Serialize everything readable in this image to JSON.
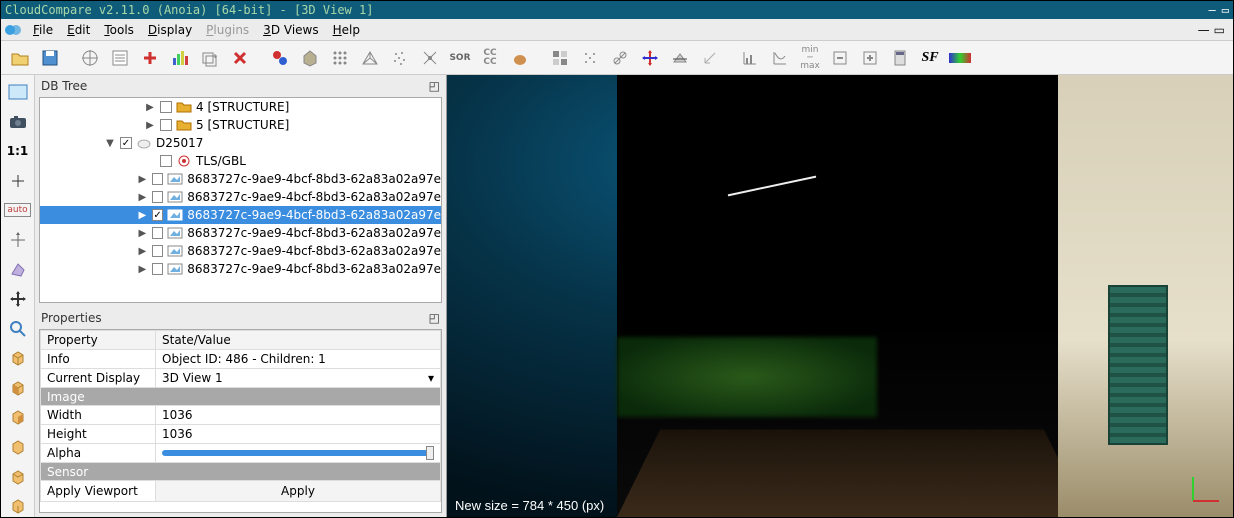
{
  "titlebar": {
    "text": "CloudCompare v2.11.0 (Anoia) [64-bit] - [3D View 1]"
  },
  "menu": {
    "items": [
      "File",
      "Edit",
      "Tools",
      "Display",
      "Plugins",
      "3D Views",
      "Help"
    ],
    "disabled_index": 4
  },
  "db_tree": {
    "title": "DB Tree",
    "rows": [
      {
        "indent": 100,
        "arrow": "▶",
        "checked": false,
        "icon": "folder",
        "label": "4 [STRUCTURE]"
      },
      {
        "indent": 100,
        "arrow": "▶",
        "checked": false,
        "icon": "folder",
        "label": "5 [STRUCTURE]"
      },
      {
        "indent": 60,
        "arrow": "▼",
        "checked": true,
        "icon": "cloud",
        "label": "D25017"
      },
      {
        "indent": 100,
        "arrow": "",
        "checked": false,
        "icon": "target",
        "label": "TLS/GBL"
      },
      {
        "indent": 100,
        "arrow": "▶",
        "checked": false,
        "icon": "image",
        "label": "8683727c-9ae9-4bcf-8bd3-62a83a02a97e"
      },
      {
        "indent": 100,
        "arrow": "▶",
        "checked": false,
        "icon": "image",
        "label": "8683727c-9ae9-4bcf-8bd3-62a83a02a97e"
      },
      {
        "indent": 100,
        "arrow": "▶",
        "checked": true,
        "icon": "image",
        "label": "8683727c-9ae9-4bcf-8bd3-62a83a02a97e",
        "selected": true
      },
      {
        "indent": 100,
        "arrow": "▶",
        "checked": false,
        "icon": "image",
        "label": "8683727c-9ae9-4bcf-8bd3-62a83a02a97e"
      },
      {
        "indent": 100,
        "arrow": "▶",
        "checked": false,
        "icon": "image",
        "label": "8683727c-9ae9-4bcf-8bd3-62a83a02a97e"
      },
      {
        "indent": 100,
        "arrow": "▶",
        "checked": false,
        "icon": "image",
        "label": "8683727c-9ae9-4bcf-8bd3-62a83a02a97e"
      }
    ]
  },
  "properties": {
    "title": "Properties",
    "header_prop": "Property",
    "header_val": "State/Value",
    "rows": [
      {
        "type": "row",
        "k": "Info",
        "v": "Object ID: 486 - Children: 1"
      },
      {
        "type": "row",
        "k": "Current Display",
        "v": "3D View 1",
        "dropdown": true
      },
      {
        "type": "section",
        "label": "Image"
      },
      {
        "type": "row",
        "k": "Width",
        "v": "1036"
      },
      {
        "type": "row",
        "k": "Height",
        "v": "1036"
      },
      {
        "type": "slider",
        "k": "Alpha"
      },
      {
        "type": "section",
        "label": "Sensor"
      },
      {
        "type": "row",
        "k": "Apply Viewport",
        "v": "",
        "button": "Apply"
      }
    ]
  },
  "viewport": {
    "status": "New size = 784 * 450 (px)"
  },
  "toolbar_icons": [
    "open",
    "save",
    "pick",
    "props",
    "plus",
    "histogram",
    "link",
    "delete",
    "colorize",
    "shield",
    "dots1",
    "mesh",
    "dots2",
    "subsample",
    "sor",
    "ccbig",
    "sphere",
    "checker",
    "stars",
    "scissors",
    "move",
    "plane",
    "angle",
    "chart1",
    "chart2",
    "minmax",
    "gridminus",
    "gridplus",
    "calc",
    "sf",
    "gradient"
  ],
  "left_icons": [
    "rect",
    "camera",
    "oneone",
    "plus2",
    "auto",
    "ortho",
    "shape",
    "cross",
    "zoom",
    "box1",
    "box2",
    "box3",
    "box4",
    "box5",
    "box6"
  ]
}
